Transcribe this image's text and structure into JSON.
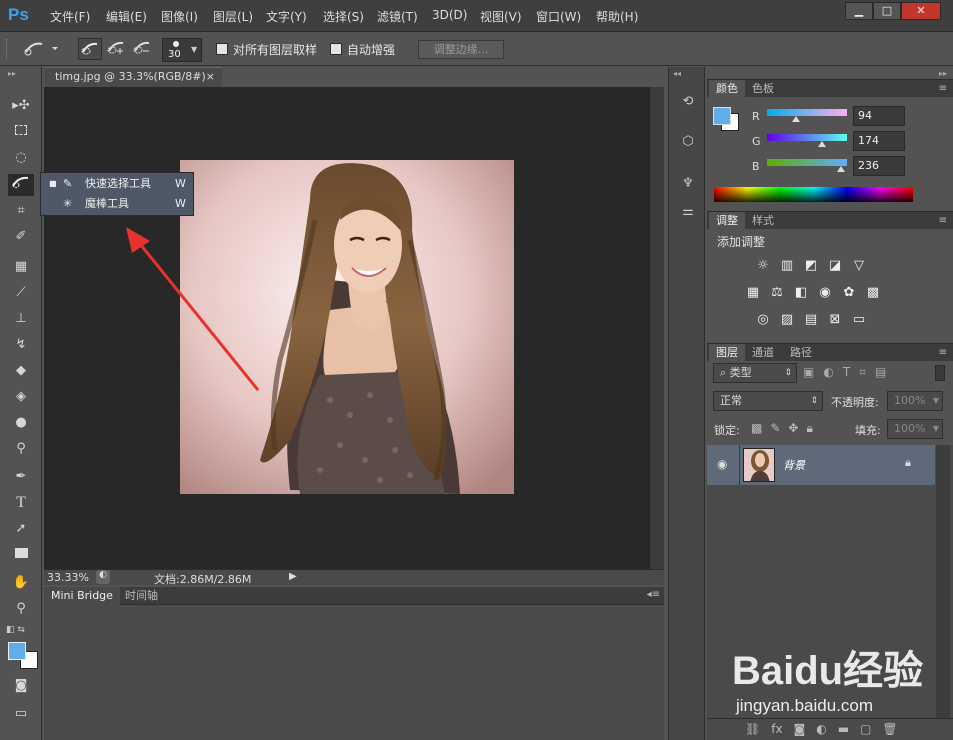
{
  "app": {
    "logo": "Ps"
  },
  "menu": [
    "文件(F)",
    "编辑(E)",
    "图像(I)",
    "图层(L)",
    "文字(Y)",
    "选择(S)",
    "滤镜(T)",
    "3D(D)",
    "视图(V)",
    "窗口(W)",
    "帮助(H)"
  ],
  "window_buttons": {
    "minimize": "▁",
    "maximize": "□",
    "close": "✕"
  },
  "options": {
    "brush_size": "30",
    "sample_all_label": "对所有图层取样",
    "auto_enhance_label": "自动增强",
    "refine_edge_label": "调整边缘..."
  },
  "document": {
    "tab_title": "timg.jpg @ 33.3%(RGB/8#)",
    "tab_close": "×",
    "zoom": "33.33%",
    "doc_info": "文档:2.86M/2.86M"
  },
  "flyout": {
    "items": [
      {
        "label": "快速选择工具",
        "shortcut": "W",
        "selected": true
      },
      {
        "label": "魔棒工具",
        "shortcut": "W",
        "selected": false
      }
    ]
  },
  "bottom_panel": {
    "tabs": [
      "Mini Bridge",
      "时间轴"
    ]
  },
  "color_panel": {
    "tabs": [
      "颜色",
      "色板"
    ],
    "r_label": "R",
    "g_label": "G",
    "b_label": "B",
    "r": "94",
    "g": "174",
    "b": "236",
    "fg_color": "#5eaeec",
    "bg_color": "#ffffff"
  },
  "adjust_panel": {
    "tabs": [
      "调整",
      "样式"
    ],
    "title": "添加调整",
    "row1": [
      "brightness-icon",
      "levels-icon",
      "curves-icon",
      "exposure-icon",
      "vibrance-icon"
    ],
    "row2": [
      "hue-saturation-icon",
      "color-balance-icon",
      "black-white-icon",
      "photo-filter-icon",
      "channel-mixer-icon",
      "color-lookup-icon"
    ],
    "row3": [
      "invert-icon",
      "posterize-icon",
      "threshold-icon",
      "selective-color-icon",
      "gradient-map-icon"
    ]
  },
  "layers_panel": {
    "tabs": [
      "图层",
      "通道",
      "路径"
    ],
    "filter_kind": "类型",
    "blend_mode": "正常",
    "opacity_label": "不透明度:",
    "opacity": "100%",
    "lock_label": "锁定:",
    "fill_label": "填充:",
    "fill": "100%",
    "layers": [
      {
        "name": "背景",
        "locked": true,
        "visible": true
      }
    ]
  },
  "watermark": {
    "brand": "Baidu经验",
    "url": "jingyan.baidu.com"
  }
}
